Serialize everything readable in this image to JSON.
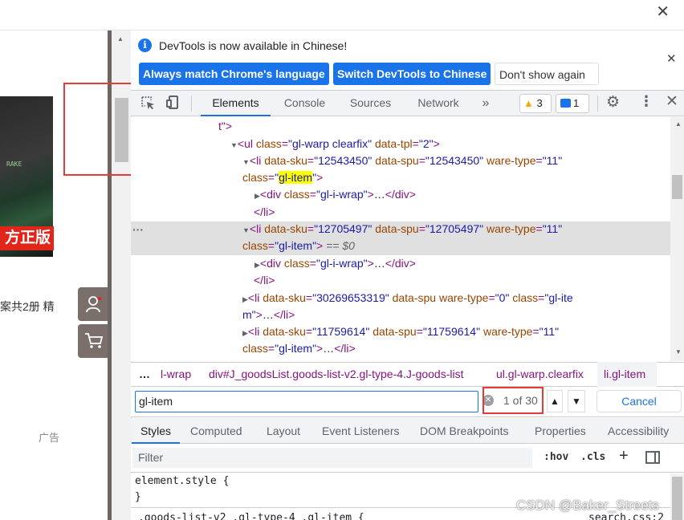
{
  "browser": {
    "close_glyph": "✕"
  },
  "page": {
    "product_art_text": "RAKE",
    "official_badge": "方正版",
    "item_desc": "案共2册 精",
    "ad_label": "广告"
  },
  "infobar": {
    "icon": "i",
    "message": "DevTools is now available in Chinese!",
    "btn_match": "Always match Chrome's language",
    "btn_switch": "Switch DevTools to Chinese",
    "btn_dont_show": "Don't show again",
    "close": "✕"
  },
  "tabs": {
    "elements": "Elements",
    "console": "Console",
    "sources": "Sources",
    "network": "Network",
    "more": "»",
    "warnings_count": "3",
    "issues_count": "1"
  },
  "dom": {
    "line1_text": "t\">",
    "ul_tag": "ul",
    "ul_class_attr": "class",
    "ul_class_val": "\"gl-warp clearfix\"",
    "ul_tpl_attr": "data-tpl",
    "ul_tpl_val": "\"2\"",
    "li1_sku": "\"12543450\"",
    "li1_spu": "\"12543450\"",
    "li1_ware": "\"11\"",
    "li1_class": "gl-item",
    "li2_sku": "\"12705497\"",
    "li2_spu": "\"12705497\"",
    "li2_ware": "\"11\"",
    "li2_class": "\"gl-item\"",
    "eq_dollar": "== $0",
    "div_class": "\"gl-i-wrap\"",
    "li3_sku": "\"30269653319\"",
    "li3_ware": "\"0\"",
    "li3_class_part": "\"gl-ite",
    "li3_class_rest": "m\"",
    "li4_sku": "\"11759614\"",
    "li4_spu": "\"11759614\"",
    "li4_ware": "\"11\"",
    "li4_class": "\"gl-item\""
  },
  "breadcrumb": {
    "dots": "…",
    "item1": "l-wrap",
    "item2": "div#J_goodsList.goods-list-v2.gl-type-4.J-goods-list",
    "item3": "ul.gl-warp.clearfix",
    "item4": "li.gl-item"
  },
  "search": {
    "value": "gl-item",
    "count": "1 of 30",
    "cancel": "Cancel"
  },
  "subtabs": {
    "styles": "Styles",
    "computed": "Computed",
    "layout": "Layout",
    "listeners": "Event Listeners",
    "dom_bp": "DOM Breakpoints",
    "props": "Properties",
    "access": "Accessibility"
  },
  "filter": {
    "placeholder": "Filter",
    "hov": ":hov",
    "cls": ".cls",
    "plus": "+"
  },
  "styles": {
    "rule1_selector": "element.style {",
    "rule1_close": "}",
    "rule2_selector": ".goods-list-v2 .gl-type-4 .gl-item {",
    "rule2_source": "search.css:2"
  },
  "watermark": "CSDN @Baker_Streets",
  "colors": {
    "accent": "#1a73e8",
    "tag": "#881280",
    "attr_name": "#994500",
    "attr_value": "#1a1aa6",
    "highlight": "#ffff00",
    "red_box": "#e63a3a",
    "badge_red": "#e1251b"
  }
}
